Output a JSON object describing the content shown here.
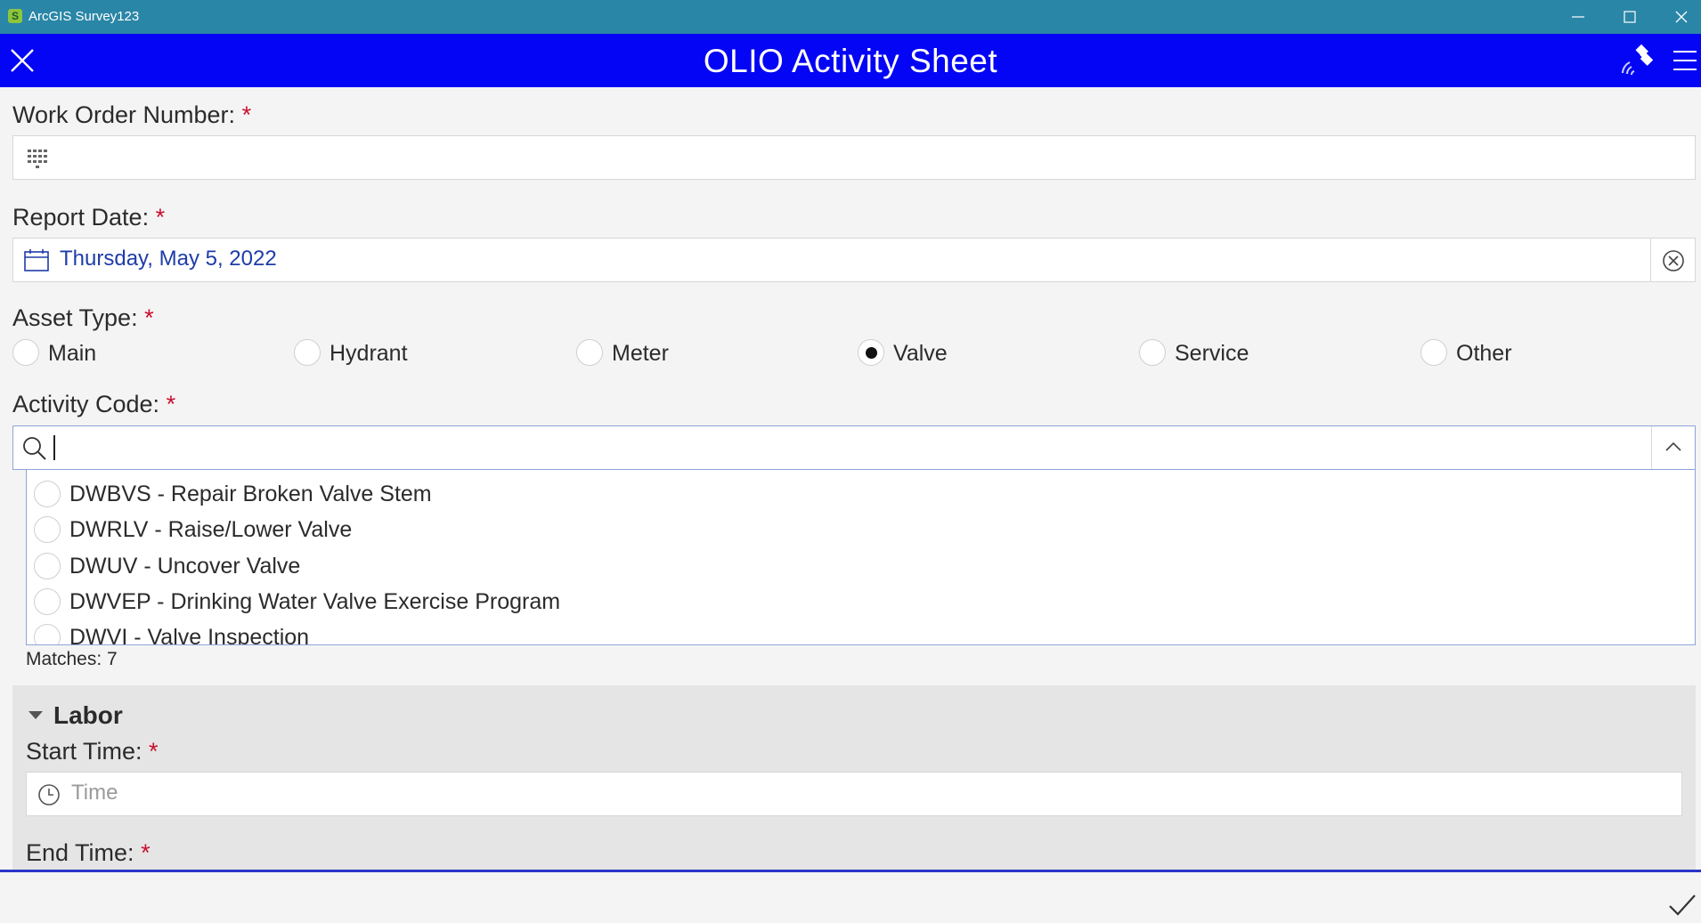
{
  "window": {
    "title": "ArcGIS Survey123",
    "app_icon_letter": "S"
  },
  "header": {
    "title": "OLIO Activity Sheet",
    "close_icon": "close-icon",
    "gps_icon": "gps-satellite-icon",
    "menu_icon": "hamburger-menu-icon"
  },
  "work_order": {
    "label": "Work Order Number:",
    "required_mark": "*",
    "value": "",
    "icon": "numeric-keypad-icon"
  },
  "report_date": {
    "label": "Report Date:",
    "required_mark": "*",
    "value": "Thursday, May 5, 2022",
    "icon": "calendar-icon",
    "clear_icon": "clear-circle-icon"
  },
  "asset_type": {
    "label": "Asset Type:",
    "required_mark": "*",
    "options": [
      {
        "label": "Main",
        "selected": false
      },
      {
        "label": "Hydrant",
        "selected": false
      },
      {
        "label": "Meter",
        "selected": false
      },
      {
        "label": "Valve",
        "selected": true
      },
      {
        "label": "Service",
        "selected": false
      },
      {
        "label": "Other",
        "selected": false
      }
    ]
  },
  "activity_code": {
    "label": "Activity Code:",
    "required_mark": "*",
    "search_value": "",
    "options": [
      "DWBVS - Repair Broken Valve Stem",
      "DWRLV - Raise/Lower Valve",
      "DWUV - Uncover Valve",
      "DWVEP - Drinking Water Valve Exercise Program",
      "DWVI - Valve Inspection"
    ],
    "matches_text": "Matches: 7"
  },
  "labor": {
    "title": "Labor",
    "start_time": {
      "label": "Start Time:",
      "required_mark": "*",
      "placeholder": "Time"
    },
    "end_time": {
      "label": "End Time:",
      "required_mark": "*"
    }
  },
  "footer": {
    "submit_icon": "checkmark-icon"
  },
  "colors": {
    "titlebar": "#2a86a6",
    "header": "#0505f5",
    "required": "#c8102e",
    "date_text": "#1f3ca8"
  }
}
